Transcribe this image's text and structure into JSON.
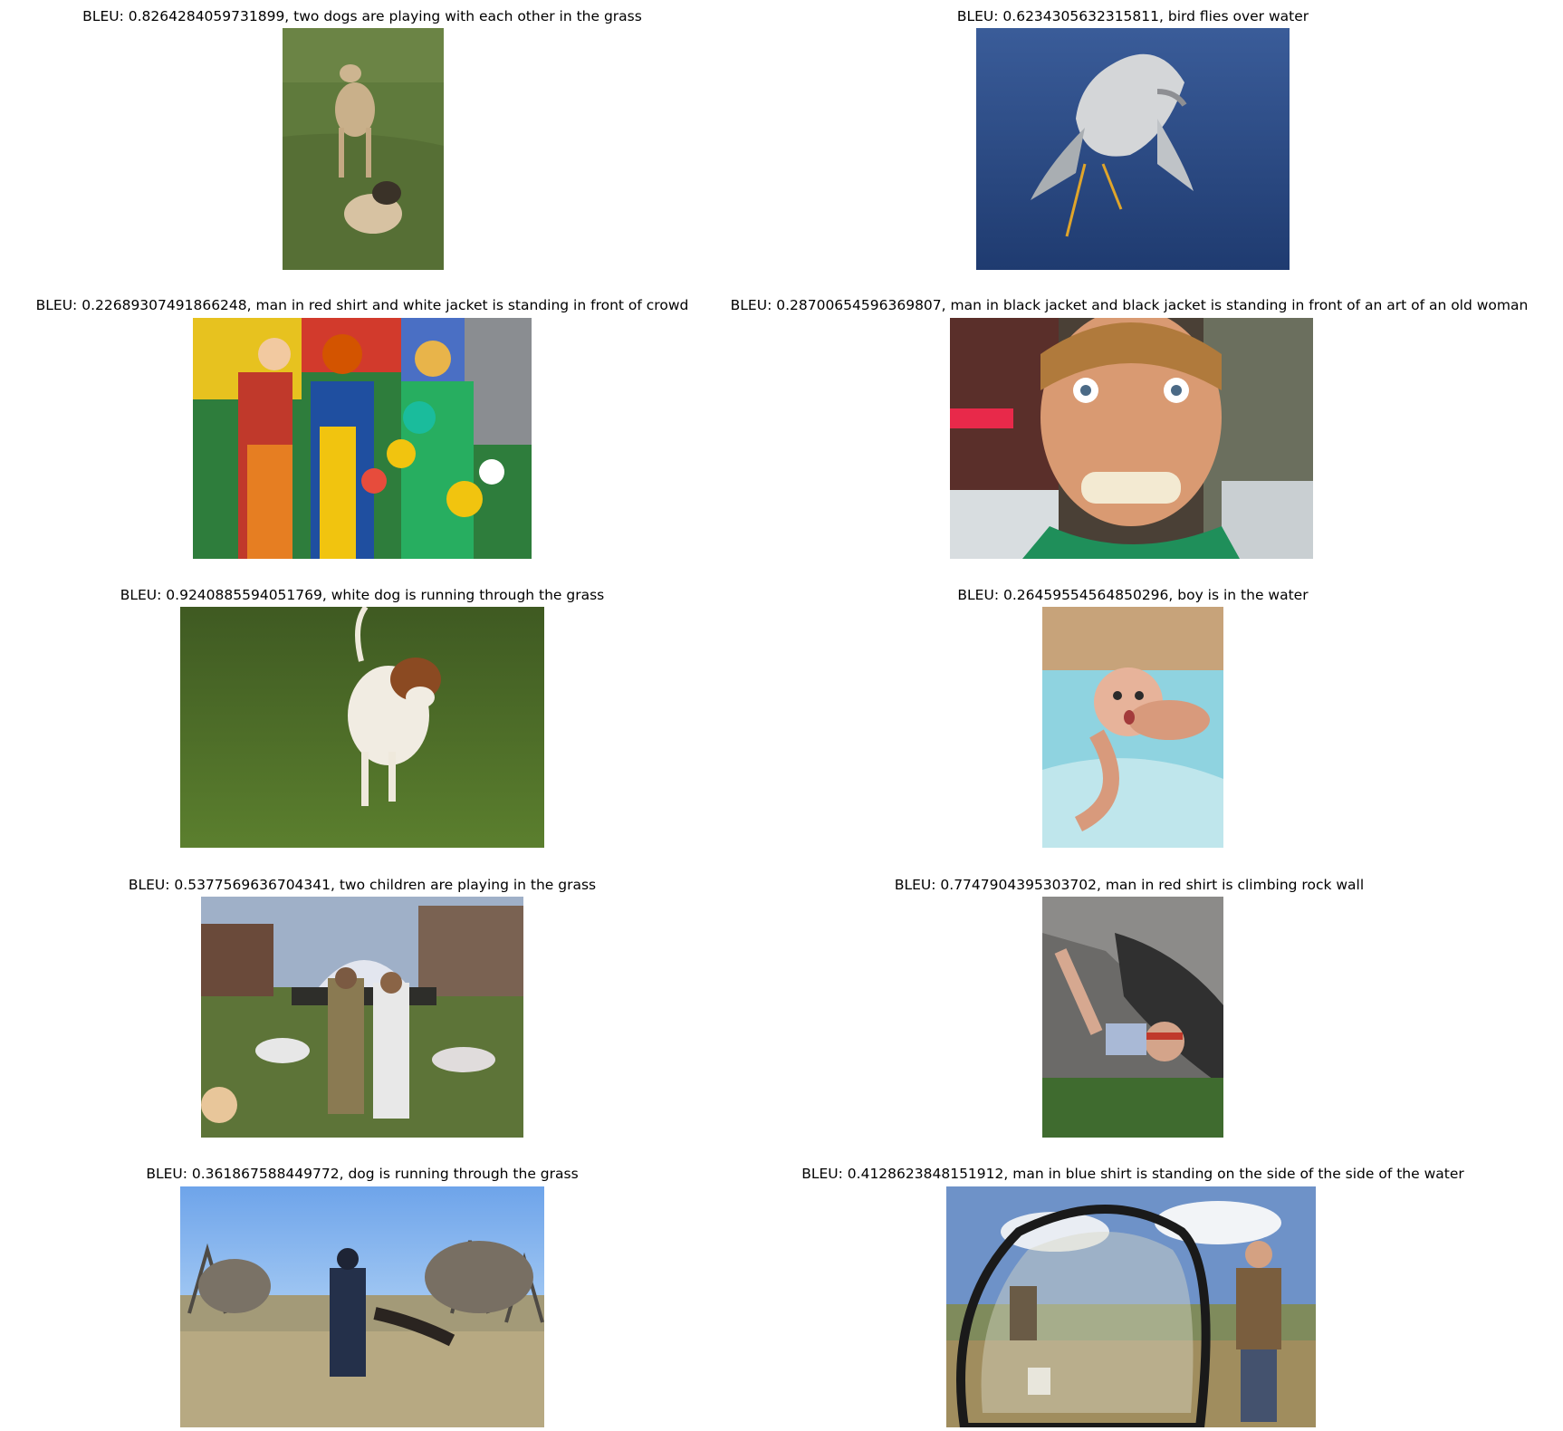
{
  "figure": {
    "panels": [
      {
        "caption": "BLEU: 0.8264284059731899, two dogs are playing with each other in the grass",
        "subject": "two dogs on a lawn"
      },
      {
        "caption": "BLEU: 0.6234305632315811, bird flies over water",
        "subject": "heron landing on blue water"
      },
      {
        "caption": "BLEU: 0.22689307491866248, man in red shirt and white jacket is standing in front of crowd",
        "subject": "colorful clowns with balloons"
      },
      {
        "caption": "BLEU: 0.28700654596369807, man in black jacket and black jacket is standing in front of an art of an old woman",
        "subject": "close-up of a grinning young man"
      },
      {
        "caption": "BLEU: 0.9240885594051769, white dog is running through the grass",
        "subject": "brown and white dog running on grass"
      },
      {
        "caption": "BLEU: 0.26459554564850296, boy is in the water",
        "subject": "baby swimming in a pool"
      },
      {
        "caption": "BLEU: 0.5377569636704341, two children are playing in the grass",
        "subject": "people on lawn near a fountain"
      },
      {
        "caption": "BLEU: 0.7747904395303702, man in red shirt is climbing rock wall",
        "subject": "man climbing a rock seen from above"
      },
      {
        "caption": "BLEU: 0.361867588449772, dog is running through the grass",
        "subject": "police officer training a dog in a park"
      },
      {
        "caption": "BLEU: 0.4128623848151912, man in blue shirt is standing on the side of the side of the water",
        "subject": "men at a baseball batting net"
      }
    ]
  },
  "colors": {
    "grass": "#5d7a3a",
    "water_blue": "#2b4f8c",
    "sky": "#8fb6e6"
  }
}
